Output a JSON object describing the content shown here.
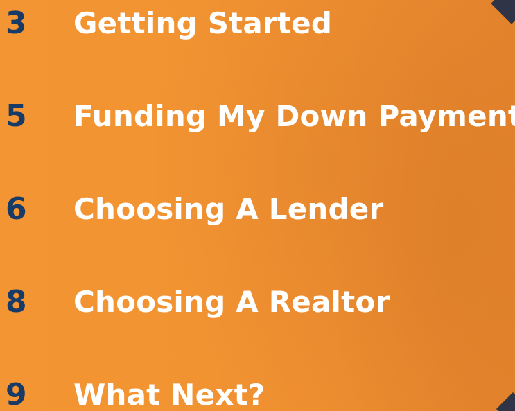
{
  "toc": {
    "items": [
      {
        "page": "3",
        "title": "Getting Started"
      },
      {
        "page": "5",
        "title": "Funding My Down Payment"
      },
      {
        "page": "6",
        "title": "Choosing A Lender"
      },
      {
        "page": "8",
        "title": "Choosing A Realtor"
      },
      {
        "page": "9",
        "title": "What Next?"
      }
    ]
  },
  "colors": {
    "background": "#f39433",
    "page_numbers": "#173a66",
    "titles": "#ffffff",
    "corner_accent": "#2f3447"
  }
}
